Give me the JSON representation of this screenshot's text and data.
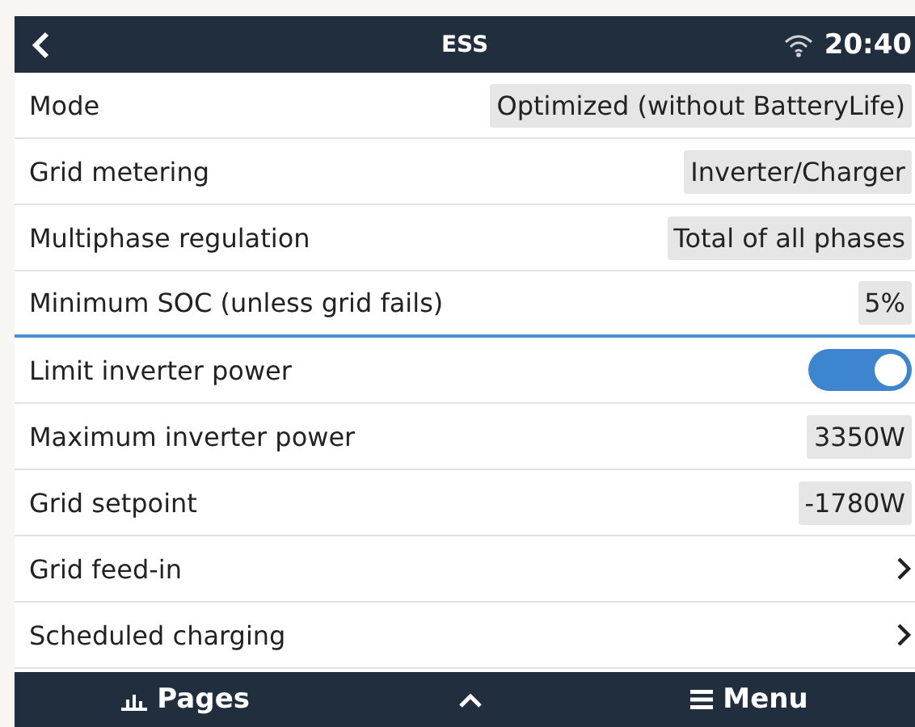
{
  "header": {
    "title": "ESS",
    "time": "20:40"
  },
  "rows": [
    {
      "kind": "value",
      "label": "Mode",
      "value": "Optimized (without BatteryLife)",
      "selected": false
    },
    {
      "kind": "value",
      "label": "Grid metering",
      "value": "Inverter/Charger",
      "selected": false
    },
    {
      "kind": "value",
      "label": "Multiphase regulation",
      "value": "Total of all phases",
      "selected": false
    },
    {
      "kind": "value",
      "label": "Minimum SOC (unless grid fails)",
      "value": "5%",
      "selected": true
    },
    {
      "kind": "toggle",
      "label": "Limit inverter power",
      "on": true,
      "selected": false
    },
    {
      "kind": "value",
      "label": "Maximum inverter power",
      "value": "3350W",
      "selected": false
    },
    {
      "kind": "value",
      "label": "Grid setpoint",
      "value": "-1780W",
      "selected": false
    },
    {
      "kind": "link",
      "label": "Grid feed-in",
      "selected": false
    },
    {
      "kind": "link",
      "label": "Scheduled charging",
      "selected": false
    }
  ],
  "footer": {
    "pages": "Pages",
    "menu": "Menu"
  }
}
